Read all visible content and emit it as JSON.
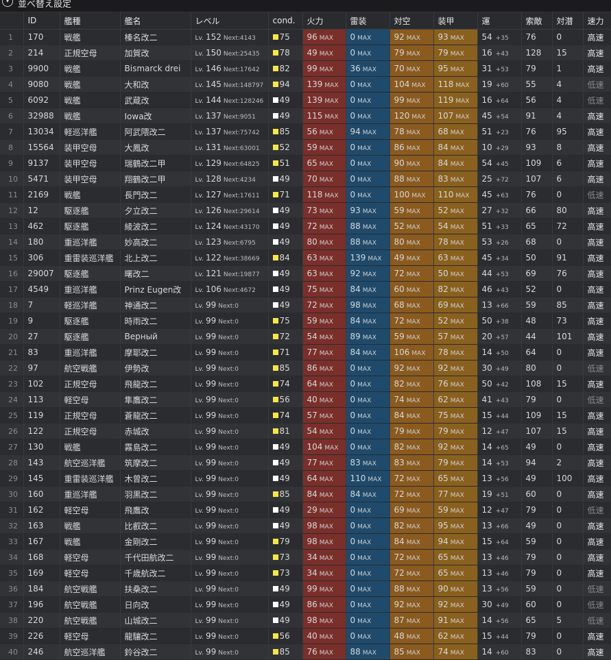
{
  "toolbar": {
    "toggle_icon": "chevron-down-icon",
    "sort_label": "並べ替え設定"
  },
  "columns": [
    "",
    "ID",
    "艦種",
    "艦名",
    "レベル",
    "cond.",
    "火力",
    "雷装",
    "対空",
    "装甲",
    "運",
    "索敵",
    "対潜",
    "速力"
  ],
  "labels": {
    "lv": "Lv.",
    "next": "Next:",
    "max": "MAX"
  },
  "colors": {
    "fire": "#7a2f2b",
    "torpedo": "#1f4a6b",
    "aa": "#8a5a1f",
    "armor": "#8a601e",
    "cond_high": "#f7e64a",
    "cond_normal": "#ffffff"
  },
  "rows": [
    {
      "no": "1",
      "id": "170",
      "type": "戦艦",
      "name": "榛名改二",
      "lv": "152",
      "next": "4143",
      "cond": "75",
      "cc": "y",
      "fire": "96",
      "torp": "0",
      "aa": "92",
      "armor": "93",
      "luck": "54",
      "lb": "+35",
      "los": "76",
      "asw": "0",
      "speed": "高速",
      "slow": false
    },
    {
      "no": "2",
      "id": "214",
      "type": "正規空母",
      "name": "加賀改",
      "lv": "150",
      "next": "25435",
      "cond": "78",
      "cc": "y",
      "fire": "49",
      "torp": "0",
      "aa": "79",
      "armor": "79",
      "luck": "16",
      "lb": "+43",
      "los": "128",
      "asw": "15",
      "speed": "高速",
      "slow": false
    },
    {
      "no": "3",
      "id": "9900",
      "type": "戦艦",
      "name": "Bismarck drei",
      "lv": "146",
      "next": "17642",
      "cond": "82",
      "cc": "y",
      "fire": "99",
      "torp": "36",
      "aa": "70",
      "armor": "95",
      "luck": "31",
      "lb": "+53",
      "los": "79",
      "asw": "1",
      "speed": "高速",
      "slow": false
    },
    {
      "no": "4",
      "id": "9080",
      "type": "戦艦",
      "name": "大和改",
      "lv": "145",
      "next": "148797",
      "cond": "94",
      "cc": "y",
      "fire": "139",
      "torp": "0",
      "aa": "104",
      "armor": "118",
      "luck": "19",
      "lb": "+60",
      "los": "55",
      "asw": "4",
      "speed": "低速",
      "slow": true
    },
    {
      "no": "5",
      "id": "6092",
      "type": "戦艦",
      "name": "武蔵改",
      "lv": "144",
      "next": "128246",
      "cond": "49",
      "cc": "w",
      "fire": "139",
      "torp": "0",
      "aa": "99",
      "armor": "119",
      "luck": "16",
      "lb": "+64",
      "los": "56",
      "asw": "4",
      "speed": "低速",
      "slow": true
    },
    {
      "no": "6",
      "id": "32988",
      "type": "戦艦",
      "name": "Iowa改",
      "lv": "137",
      "next": "9051",
      "cond": "49",
      "cc": "w",
      "fire": "115",
      "torp": "0",
      "aa": "120",
      "armor": "107",
      "luck": "45",
      "lb": "+54",
      "los": "91",
      "asw": "4",
      "speed": "高速",
      "slow": false
    },
    {
      "no": "7",
      "id": "13034",
      "type": "軽巡洋艦",
      "name": "阿武隈改二",
      "lv": "137",
      "next": "75742",
      "cond": "85",
      "cc": "y",
      "fire": "56",
      "torp": "94",
      "aa": "78",
      "armor": "68",
      "luck": "51",
      "lb": "+23",
      "los": "76",
      "asw": "95",
      "speed": "高速",
      "slow": false
    },
    {
      "no": "8",
      "id": "15564",
      "type": "装甲空母",
      "name": "大鳳改",
      "lv": "131",
      "next": "63001",
      "cond": "52",
      "cc": "y",
      "fire": "59",
      "torp": "0",
      "aa": "86",
      "armor": "84",
      "luck": "10",
      "lb": "+29",
      "los": "93",
      "asw": "8",
      "speed": "高速",
      "slow": false
    },
    {
      "no": "9",
      "id": "9137",
      "type": "装甲空母",
      "name": "瑞鶴改二甲",
      "lv": "129",
      "next": "64825",
      "cond": "51",
      "cc": "y",
      "fire": "65",
      "torp": "0",
      "aa": "90",
      "armor": "84",
      "luck": "54",
      "lb": "+45",
      "los": "109",
      "asw": "6",
      "speed": "高速",
      "slow": false
    },
    {
      "no": "10",
      "id": "5471",
      "type": "装甲空母",
      "name": "翔鶴改二甲",
      "lv": "128",
      "next": "4234",
      "cond": "49",
      "cc": "w",
      "fire": "70",
      "torp": "0",
      "aa": "88",
      "armor": "83",
      "luck": "25",
      "lb": "+72",
      "los": "107",
      "asw": "6",
      "speed": "高速",
      "slow": false
    },
    {
      "no": "11",
      "id": "2169",
      "type": "戦艦",
      "name": "長門改二",
      "lv": "127",
      "next": "17611",
      "cond": "71",
      "cc": "y",
      "fire": "118",
      "torp": "0",
      "aa": "100",
      "armor": "110",
      "luck": "45",
      "lb": "+63",
      "los": "76",
      "asw": "0",
      "speed": "低速",
      "slow": true
    },
    {
      "no": "12",
      "id": "12",
      "type": "駆逐艦",
      "name": "夕立改二",
      "lv": "126",
      "next": "29614",
      "cond": "49",
      "cc": "w",
      "fire": "73",
      "torp": "93",
      "aa": "59",
      "armor": "52",
      "luck": "27",
      "lb": "+32",
      "los": "66",
      "asw": "80",
      "speed": "高速",
      "slow": false
    },
    {
      "no": "13",
      "id": "462",
      "type": "駆逐艦",
      "name": "綾波改二",
      "lv": "124",
      "next": "43170",
      "cond": "49",
      "cc": "w",
      "fire": "72",
      "torp": "88",
      "aa": "52",
      "armor": "54",
      "luck": "51",
      "lb": "+33",
      "los": "65",
      "asw": "72",
      "speed": "高速",
      "slow": false
    },
    {
      "no": "14",
      "id": "180",
      "type": "重巡洋艦",
      "name": "妙高改二",
      "lv": "123",
      "next": "6795",
      "cond": "49",
      "cc": "w",
      "fire": "80",
      "torp": "88",
      "aa": "80",
      "armor": "78",
      "luck": "53",
      "lb": "+26",
      "los": "68",
      "asw": "0",
      "speed": "高速",
      "slow": false
    },
    {
      "no": "15",
      "id": "306",
      "type": "重雷装巡洋艦",
      "name": "北上改二",
      "lv": "122",
      "next": "38669",
      "cond": "84",
      "cc": "y",
      "fire": "63",
      "torp": "139",
      "aa": "49",
      "armor": "63",
      "luck": "45",
      "lb": "+34",
      "los": "50",
      "asw": "91",
      "speed": "高速",
      "slow": false
    },
    {
      "no": "16",
      "id": "29007",
      "type": "駆逐艦",
      "name": "曙改二",
      "lv": "121",
      "next": "19877",
      "cond": "49",
      "cc": "w",
      "fire": "63",
      "torp": "92",
      "aa": "72",
      "armor": "50",
      "luck": "44",
      "lb": "+53",
      "los": "69",
      "asw": "76",
      "speed": "高速",
      "slow": false
    },
    {
      "no": "17",
      "id": "4549",
      "type": "重巡洋艦",
      "name": "Prinz Eugen改",
      "lv": "106",
      "next": "4672",
      "cond": "49",
      "cc": "w",
      "fire": "75",
      "torp": "84",
      "aa": "60",
      "armor": "82",
      "luck": "46",
      "lb": "+43",
      "los": "52",
      "asw": "0",
      "speed": "高速",
      "slow": false
    },
    {
      "no": "18",
      "id": "7",
      "type": "軽巡洋艦",
      "name": "神通改二",
      "lv": "99",
      "next": "0",
      "cond": "49",
      "cc": "w",
      "fire": "72",
      "torp": "98",
      "aa": "68",
      "armor": "69",
      "luck": "13",
      "lb": "+66",
      "los": "59",
      "asw": "85",
      "speed": "高速",
      "slow": false
    },
    {
      "no": "19",
      "id": "9",
      "type": "駆逐艦",
      "name": "時雨改二",
      "lv": "99",
      "next": "0",
      "cond": "75",
      "cc": "y",
      "fire": "59",
      "torp": "84",
      "aa": "72",
      "armor": "52",
      "luck": "50",
      "lb": "+38",
      "los": "48",
      "asw": "73",
      "speed": "高速",
      "slow": false
    },
    {
      "no": "20",
      "id": "27",
      "type": "駆逐艦",
      "name": "Верный",
      "lv": "99",
      "next": "0",
      "cond": "72",
      "cc": "y",
      "fire": "54",
      "torp": "89",
      "aa": "59",
      "armor": "57",
      "luck": "20",
      "lb": "+57",
      "los": "44",
      "asw": "101",
      "speed": "高速",
      "slow": false
    },
    {
      "no": "21",
      "id": "83",
      "type": "重巡洋艦",
      "name": "摩耶改二",
      "lv": "99",
      "next": "0",
      "cond": "71",
      "cc": "y",
      "fire": "77",
      "torp": "84",
      "aa": "106",
      "armor": "78",
      "luck": "14",
      "lb": "+50",
      "los": "64",
      "asw": "0",
      "speed": "高速",
      "slow": false
    },
    {
      "no": "22",
      "id": "97",
      "type": "航空戦艦",
      "name": "伊勢改",
      "lv": "99",
      "next": "0",
      "cond": "85",
      "cc": "y",
      "fire": "86",
      "torp": "0",
      "aa": "92",
      "armor": "92",
      "luck": "30",
      "lb": "+49",
      "los": "80",
      "asw": "0",
      "speed": "低速",
      "slow": true
    },
    {
      "no": "23",
      "id": "102",
      "type": "正規空母",
      "name": "飛龍改二",
      "lv": "99",
      "next": "0",
      "cond": "74",
      "cc": "y",
      "fire": "64",
      "torp": "0",
      "aa": "82",
      "armor": "76",
      "luck": "50",
      "lb": "+42",
      "los": "108",
      "asw": "15",
      "speed": "高速",
      "slow": false
    },
    {
      "no": "24",
      "id": "113",
      "type": "軽空母",
      "name": "隼鷹改二",
      "lv": "99",
      "next": "0",
      "cond": "56",
      "cc": "y",
      "fire": "40",
      "torp": "0",
      "aa": "74",
      "armor": "62",
      "luck": "41",
      "lb": "+43",
      "los": "79",
      "asw": "0",
      "speed": "低速",
      "slow": true
    },
    {
      "no": "25",
      "id": "119",
      "type": "正規空母",
      "name": "蒼龍改二",
      "lv": "99",
      "next": "0",
      "cond": "74",
      "cc": "y",
      "fire": "57",
      "torp": "0",
      "aa": "84",
      "armor": "75",
      "luck": "15",
      "lb": "+44",
      "los": "109",
      "asw": "15",
      "speed": "高速",
      "slow": false
    },
    {
      "no": "26",
      "id": "122",
      "type": "正規空母",
      "name": "赤城改",
      "lv": "99",
      "next": "0",
      "cond": "81",
      "cc": "y",
      "fire": "54",
      "torp": "0",
      "aa": "79",
      "armor": "79",
      "luck": "12",
      "lb": "+47",
      "los": "107",
      "asw": "15",
      "speed": "高速",
      "slow": false
    },
    {
      "no": "27",
      "id": "130",
      "type": "戦艦",
      "name": "霧島改二",
      "lv": "99",
      "next": "0",
      "cond": "49",
      "cc": "w",
      "fire": "104",
      "torp": "0",
      "aa": "82",
      "armor": "92",
      "luck": "14",
      "lb": "+65",
      "los": "49",
      "asw": "0",
      "speed": "高速",
      "slow": false
    },
    {
      "no": "28",
      "id": "143",
      "type": "航空巡洋艦",
      "name": "筑摩改二",
      "lv": "99",
      "next": "0",
      "cond": "49",
      "cc": "w",
      "fire": "77",
      "torp": "83",
      "aa": "83",
      "armor": "79",
      "luck": "14",
      "lb": "+53",
      "los": "94",
      "asw": "2",
      "speed": "高速",
      "slow": false
    },
    {
      "no": "29",
      "id": "145",
      "type": "重雷装巡洋艦",
      "name": "木曾改二",
      "lv": "99",
      "next": "0",
      "cond": "49",
      "cc": "w",
      "fire": "64",
      "torp": "110",
      "aa": "72",
      "armor": "65",
      "luck": "13",
      "lb": "+56",
      "los": "49",
      "asw": "100",
      "speed": "高速",
      "slow": false
    },
    {
      "no": "30",
      "id": "160",
      "type": "重巡洋艦",
      "name": "羽黒改二",
      "lv": "99",
      "next": "0",
      "cond": "85",
      "cc": "y",
      "fire": "84",
      "torp": "84",
      "aa": "72",
      "armor": "77",
      "luck": "19",
      "lb": "+51",
      "los": "60",
      "asw": "0",
      "speed": "高速",
      "slow": false
    },
    {
      "no": "31",
      "id": "162",
      "type": "軽空母",
      "name": "飛鷹改",
      "lv": "99",
      "next": "0",
      "cond": "49",
      "cc": "w",
      "fire": "29",
      "torp": "0",
      "aa": "69",
      "armor": "59",
      "luck": "12",
      "lb": "+47",
      "los": "79",
      "asw": "0",
      "speed": "低速",
      "slow": true
    },
    {
      "no": "32",
      "id": "163",
      "type": "戦艦",
      "name": "比叡改二",
      "lv": "99",
      "next": "0",
      "cond": "49",
      "cc": "w",
      "fire": "98",
      "torp": "0",
      "aa": "82",
      "armor": "95",
      "luck": "13",
      "lb": "+66",
      "los": "49",
      "asw": "0",
      "speed": "高速",
      "slow": false
    },
    {
      "no": "33",
      "id": "167",
      "type": "戦艦",
      "name": "金剛改二",
      "lv": "99",
      "next": "0",
      "cond": "79",
      "cc": "y",
      "fire": "98",
      "torp": "0",
      "aa": "84",
      "armor": "94",
      "luck": "15",
      "lb": "+64",
      "los": "59",
      "asw": "0",
      "speed": "高速",
      "slow": false
    },
    {
      "no": "34",
      "id": "168",
      "type": "軽空母",
      "name": "千代田航改二",
      "lv": "99",
      "next": "0",
      "cond": "73",
      "cc": "y",
      "fire": "34",
      "torp": "0",
      "aa": "72",
      "armor": "65",
      "luck": "13",
      "lb": "+46",
      "los": "79",
      "asw": "0",
      "speed": "高速",
      "slow": false
    },
    {
      "no": "35",
      "id": "169",
      "type": "軽空母",
      "name": "千歳航改二",
      "lv": "99",
      "next": "0",
      "cond": "73",
      "cc": "y",
      "fire": "34",
      "torp": "0",
      "aa": "72",
      "armor": "65",
      "luck": "13",
      "lb": "+46",
      "los": "79",
      "asw": "0",
      "speed": "高速",
      "slow": false
    },
    {
      "no": "36",
      "id": "184",
      "type": "航空戦艦",
      "name": "扶桑改二",
      "lv": "99",
      "next": "0",
      "cond": "49",
      "cc": "w",
      "fire": "99",
      "torp": "0",
      "aa": "88",
      "armor": "90",
      "luck": "13",
      "lb": "+56",
      "los": "59",
      "asw": "0",
      "speed": "低速",
      "slow": true
    },
    {
      "no": "37",
      "id": "196",
      "type": "航空戦艦",
      "name": "日向改",
      "lv": "99",
      "next": "0",
      "cond": "49",
      "cc": "w",
      "fire": "86",
      "torp": "0",
      "aa": "92",
      "armor": "92",
      "luck": "30",
      "lb": "+49",
      "los": "60",
      "asw": "0",
      "speed": "低速",
      "slow": true
    },
    {
      "no": "38",
      "id": "220",
      "type": "航空戦艦",
      "name": "山城改二",
      "lv": "99",
      "next": "0",
      "cond": "49",
      "cc": "w",
      "fire": "98",
      "torp": "0",
      "aa": "87",
      "armor": "91",
      "luck": "14",
      "lb": "+56",
      "los": "65",
      "asw": "5",
      "speed": "低速",
      "slow": true
    },
    {
      "no": "39",
      "id": "226",
      "type": "軽空母",
      "name": "龍驤改二",
      "lv": "99",
      "next": "0",
      "cond": "56",
      "cc": "y",
      "fire": "40",
      "torp": "0",
      "aa": "48",
      "armor": "62",
      "luck": "15",
      "lb": "+44",
      "los": "79",
      "asw": "0",
      "speed": "高速",
      "slow": false
    },
    {
      "no": "40",
      "id": "246",
      "type": "航空巡洋艦",
      "name": "鈴谷改二",
      "lv": "99",
      "next": "0",
      "cond": "85",
      "cc": "y",
      "fire": "76",
      "torp": "88",
      "aa": "85",
      "armor": "74",
      "luck": "14",
      "lb": "+60",
      "los": "83",
      "asw": "0",
      "speed": "高速",
      "slow": false
    }
  ]
}
